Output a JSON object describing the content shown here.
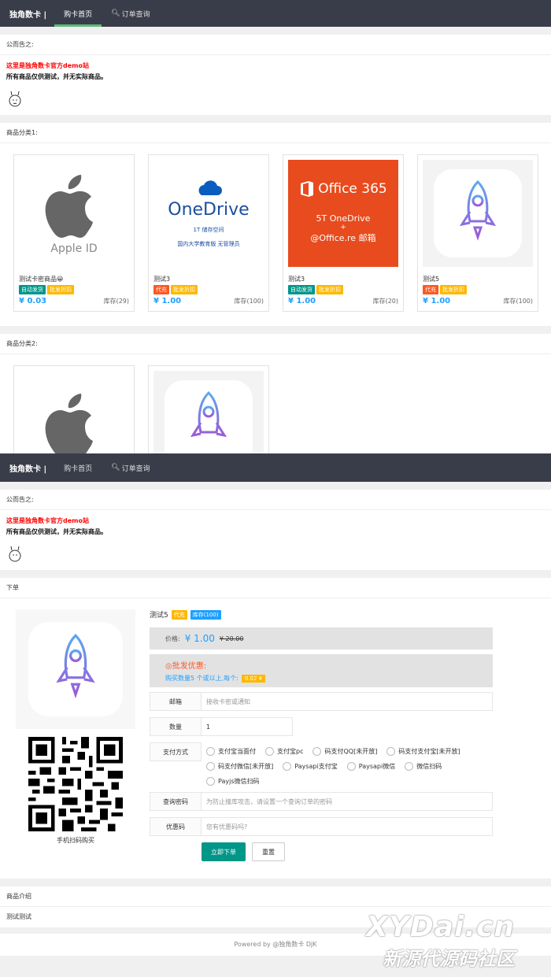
{
  "nav": {
    "brand": "独角数卡 |",
    "home": "购卡首页",
    "query": "订单查询"
  },
  "notice": {
    "header": "公而告之:",
    "red": "这里是独角数卡官方demo站",
    "black": "所有商品仅供测试，并无实际商品。"
  },
  "cat1": {
    "header": "商品分类1:",
    "cards": [
      {
        "name": "测试卡密商品😀",
        "tag1": "自动发货",
        "tag2": "批发折扣",
        "price": "¥ 0.03",
        "stock": "库存(29)",
        "img_text": "Apple ID"
      },
      {
        "name": "测试3",
        "tag1": "代充",
        "tag2": "批发折扣",
        "price": "¥ 1.00",
        "stock": "库存(100)",
        "img_title": "OneDrive",
        "img_sub1": "1T 储存空间",
        "img_sub2": "国内大学教育版 无管理员"
      },
      {
        "name": "测试3",
        "tag1": "自动发货",
        "tag2": "批发折扣",
        "price": "¥ 1.00",
        "stock": "库存(20)",
        "img_title": "Office 365",
        "img_l1": "5T  OneDrive",
        "img_l2": "+",
        "img_l3": "@Office.re 邮箱"
      },
      {
        "name": "测试5",
        "tag1": "代充",
        "tag2": "批发折扣",
        "price": "¥ 1.00",
        "stock": "库存(100)"
      }
    ]
  },
  "cat2": {
    "header": "商品分类2:"
  },
  "order": {
    "header": "下单",
    "title": "测试5",
    "tag": "代充",
    "stock_tag": "库存(100)",
    "price_label": "价格:",
    "price": "¥ 1.00",
    "old_price": "¥ 20.00",
    "whole_title": "◎批发优惠:",
    "whole_desc": "购买数量5 个或以上,每个:",
    "whole_price": "0.02 ¥",
    "email_label": "邮箱",
    "email_ph": "接收卡密或通知",
    "qty_label": "数量",
    "qty_value": "1",
    "pay_label": "支付方式",
    "pay_opts": [
      "支付宝当面付",
      "支付宝pc",
      "码支付QQ[未开放]",
      "码支付支付宝[未开放]",
      "码支付微信[未开放]",
      "Paysapi支付宝",
      "Paysapi微信",
      "微信扫码",
      "Payjs微信扫码"
    ],
    "pwd_label": "查询密码",
    "pwd_ph": "为防止撞库攻击，请设置一个查询订单的密码",
    "coupon_label": "优惠码",
    "coupon_ph": "您有优惠码吗?",
    "submit": "立即下单",
    "reset": "重置",
    "qr_label": "手机扫码购买"
  },
  "intro": {
    "header": "商品介绍",
    "content": "测试测试"
  },
  "footer": "Powered by @独角数卡 DJK",
  "watermark": {
    "line1": "XYDai.cn",
    "line2": "新源代源码社区"
  }
}
